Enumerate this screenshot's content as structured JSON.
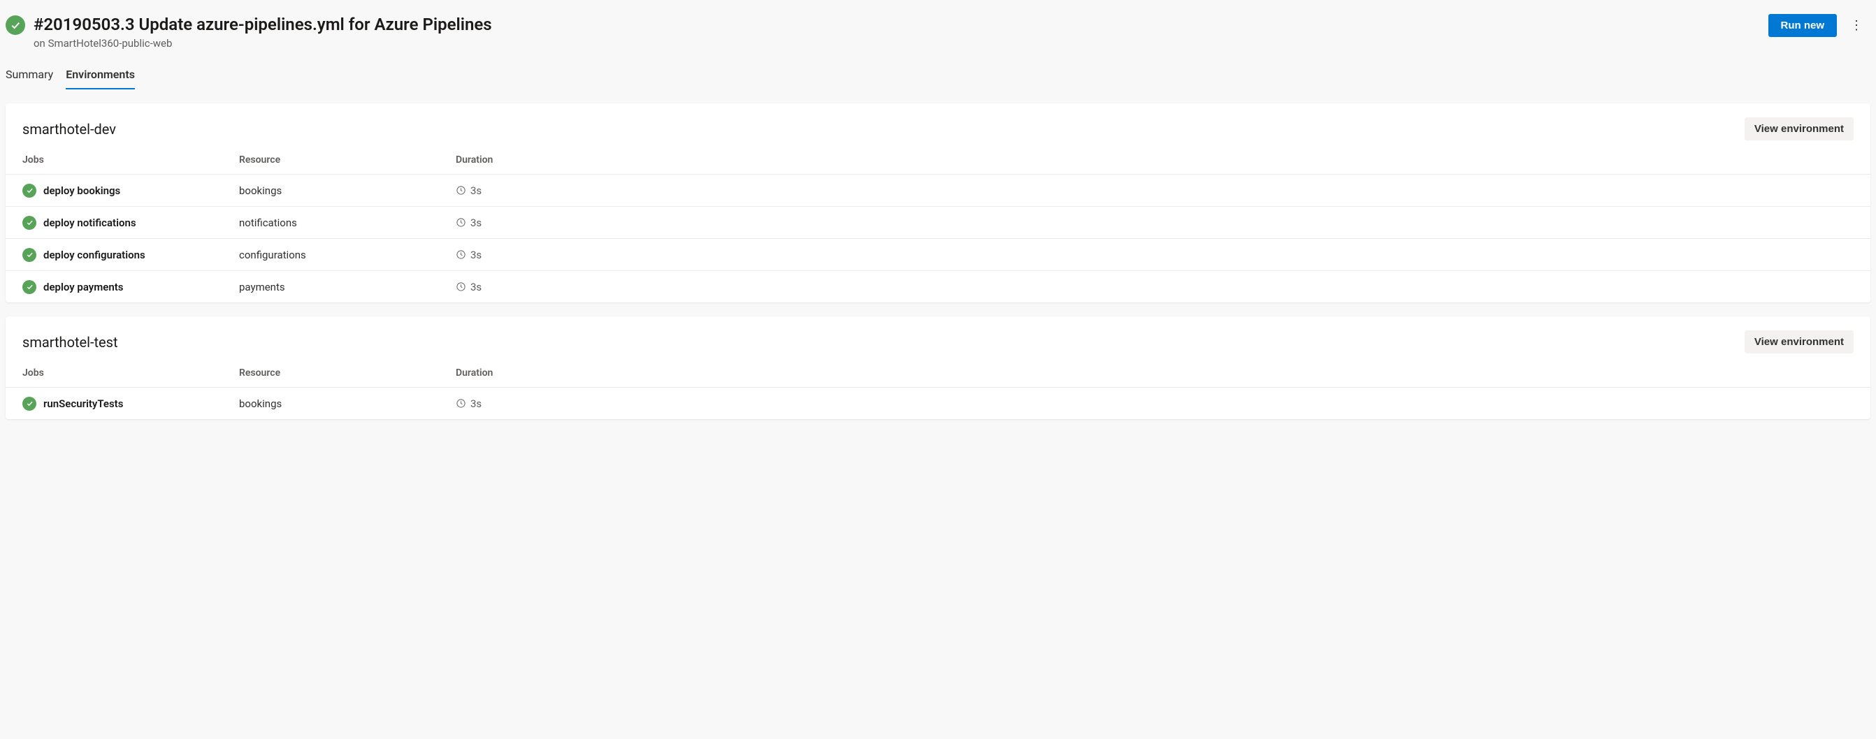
{
  "header": {
    "title": "#20190503.3 Update azure-pipelines.yml for Azure Pipelines",
    "subtitle_prefix": "on ",
    "subtitle_repo": "SmartHotel360-public-web",
    "run_new_label": "Run new"
  },
  "tabs": [
    {
      "label": "Summary",
      "active": false
    },
    {
      "label": "Environments",
      "active": true
    }
  ],
  "columns": {
    "jobs": "Jobs",
    "resource": "Resource",
    "duration": "Duration"
  },
  "view_env_label": "View environment",
  "environments": [
    {
      "name": "smarthotel-dev",
      "jobs": [
        {
          "job": "deploy bookings",
          "resource": "bookings",
          "duration": "3s"
        },
        {
          "job": "deploy notifications",
          "resource": "notifications",
          "duration": "3s"
        },
        {
          "job": "deploy configurations",
          "resource": "configurations",
          "duration": "3s"
        },
        {
          "job": "deploy payments",
          "resource": "payments",
          "duration": "3s"
        }
      ]
    },
    {
      "name": "smarthotel-test",
      "jobs": [
        {
          "job": "runSecurityTests",
          "resource": "bookings",
          "duration": "3s"
        }
      ]
    }
  ]
}
